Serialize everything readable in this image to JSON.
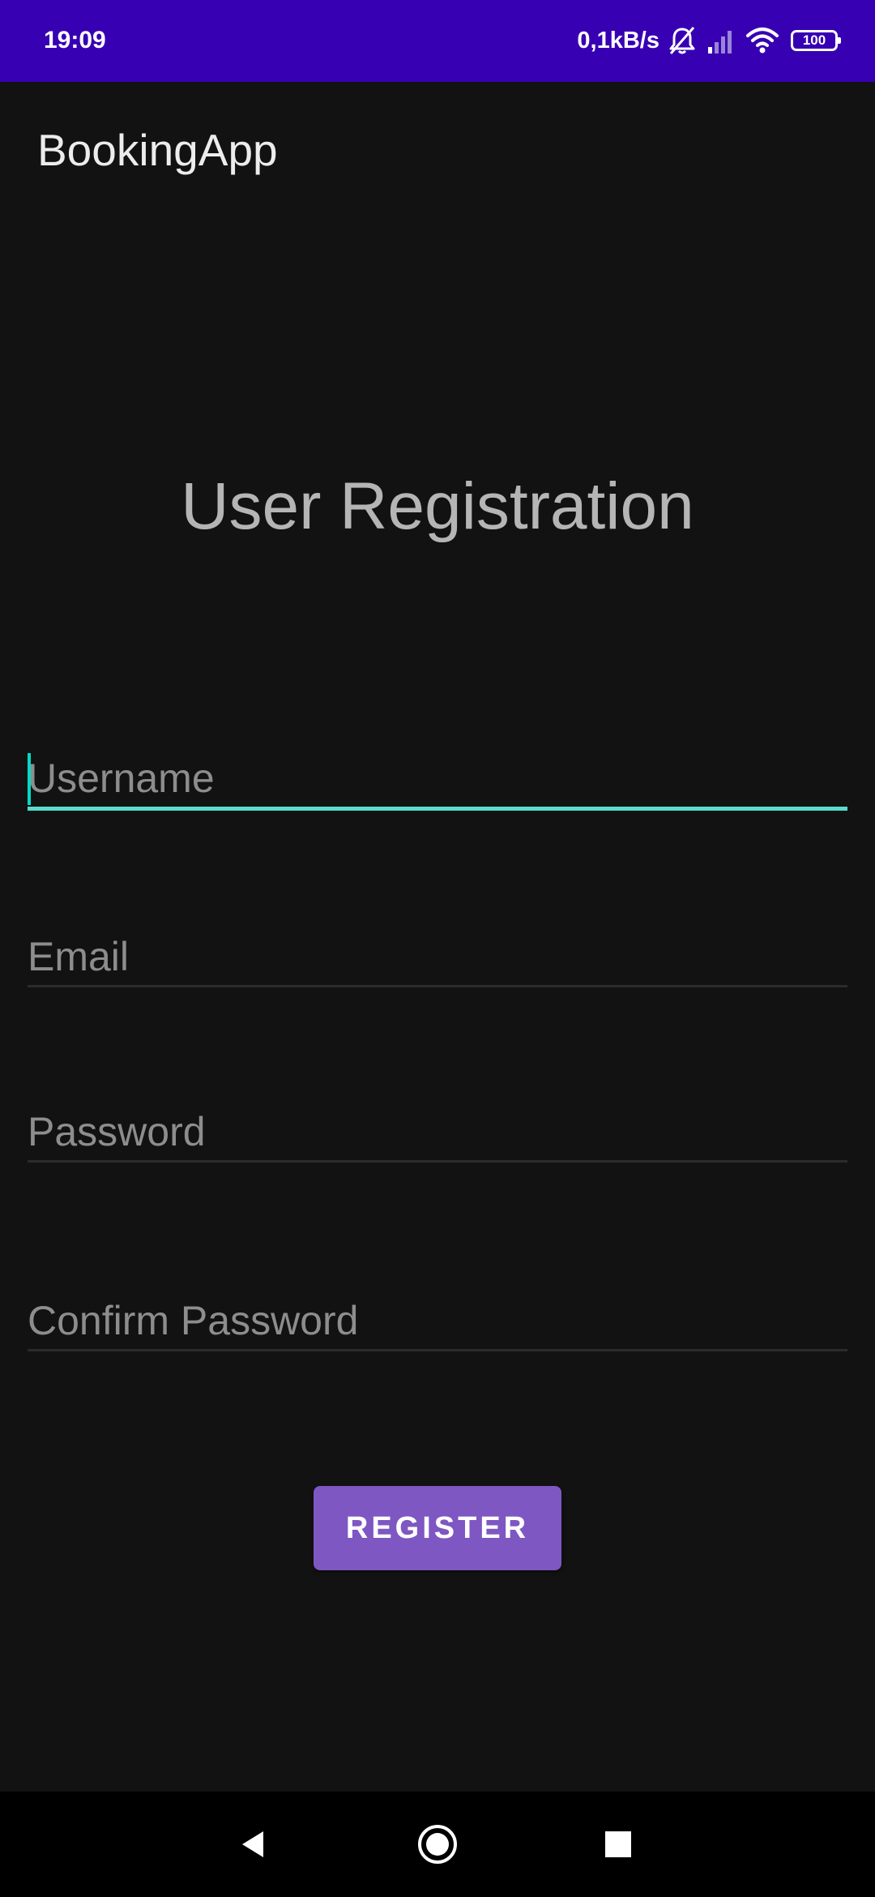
{
  "status_bar": {
    "time": "19:09",
    "net_speed": "0,1kB/s",
    "battery": "100",
    "icons": [
      "bell-muted-icon",
      "signal-icon",
      "wifi-icon",
      "battery-icon"
    ],
    "background_color": "#3700b3"
  },
  "app_bar": {
    "title": "BookingApp"
  },
  "form": {
    "heading": "User Registration",
    "username_placeholder": "Username",
    "email_placeholder": "Email",
    "password_placeholder": "Password",
    "confirm_password_placeholder": "Confirm Password",
    "focused_field": "username",
    "focus_color": "#58dccf"
  },
  "register_button": {
    "label": "REGISTER",
    "color": "#7e57c2"
  },
  "nav_bar": {
    "icons": [
      "back-icon",
      "home-icon",
      "recents-icon"
    ]
  }
}
